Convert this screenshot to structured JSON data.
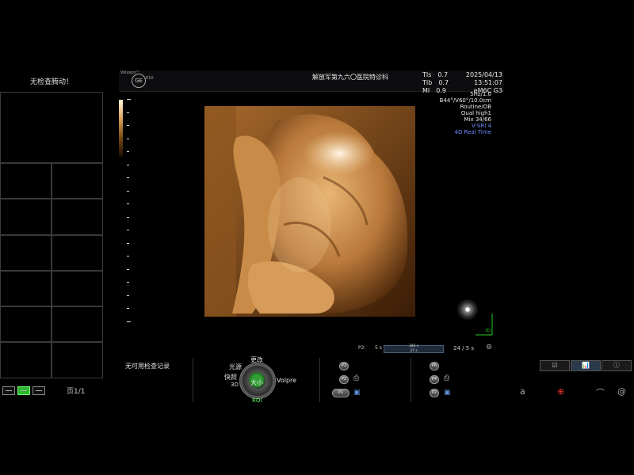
{
  "left_panel": {
    "message": "无检查腾动！",
    "page_label": "页1/1"
  },
  "header": {
    "brand_voluson": "Voluson™",
    "brand_ge": "GE",
    "brand_model": "E10",
    "facility": "解放军第九六〇医院特诊科",
    "tis": [
      {
        "label": "TIs",
        "value": "0.7"
      },
      {
        "label": "TIb",
        "value": "0.7"
      },
      {
        "label": "MI",
        "value": "0.9"
      }
    ],
    "date": "2025/04/13",
    "time": "13:51:07",
    "probe": "eM6C G3"
  },
  "params": {
    "lines": [
      "5Hz/1.0",
      "B44°/V60°/10.0cm",
      "Routine/OB",
      "Qual high1",
      "Mix 34/66"
    ],
    "mode_lines": [
      "V-SRI 4",
      "4D Real Time"
    ]
  },
  "render": {
    "axis_label": "3D"
  },
  "cine": {
    "label": "P2:",
    "left_value": "5 s",
    "top_value": "180 s",
    "bottom_value": "37 s",
    "rate": "24 / 5 s"
  },
  "bottom": {
    "no_records": "无可用检查记录",
    "dial": {
      "center": "大小",
      "top": "更改",
      "upper_left": "光源",
      "left": "快照",
      "left_sub": "3D",
      "right": "Volpre",
      "bottom": "ROI"
    },
    "buttons_mid": [
      "P3",
      "P2",
      "P1"
    ],
    "buttons_right": [
      "P6",
      "P4",
      "P2"
    ]
  },
  "right_icons": [
    "a",
    "⊕",
    "⌒",
    "@"
  ],
  "colors": {
    "accent_green": "#2db82d",
    "tint_blue": "#6f8cff",
    "background": "#000000"
  }
}
